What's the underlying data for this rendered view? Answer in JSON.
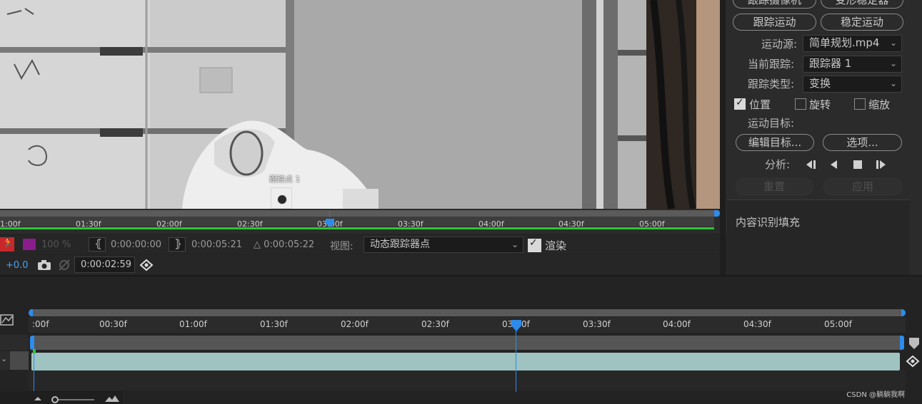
{
  "viewer": {
    "track_point_label": "跟踪点 1"
  },
  "viewer_ruler": {
    "ticks": [
      "1:00f",
      "01:30f",
      "02:00f",
      "02:30f",
      "03:00f",
      "03:30f",
      "04:00f",
      "04:30f",
      "05:00f"
    ]
  },
  "viewer_controls": {
    "zoom": "100 %",
    "in_point": "0:00:00:00",
    "out_point": "0:00:05:21",
    "duration": "△ 0:00:05:22",
    "view_label": "视图:",
    "view_value": "动态跟踪器点",
    "render_label": "渲染",
    "exposure": "+0.0",
    "current_time": "0:00:02:59"
  },
  "tracker_panel": {
    "top_buttons": [
      "跟踪摄像机",
      "变形稳定器"
    ],
    "track_motion": "跟踪运动",
    "stabilize_motion": "稳定运动",
    "motion_source_label": "运动源:",
    "motion_source_value": "简单规划.mp4",
    "current_track_label": "当前跟踪:",
    "current_track_value": "跟踪器 1",
    "track_type_label": "跟踪类型:",
    "track_type_value": "变换",
    "position_label": "位置",
    "rotation_label": "旋转",
    "scale_label": "缩放",
    "motion_target_label": "运动目标:",
    "edit_target": "编辑目标...",
    "options": "选项...",
    "analyze_label": "分析:",
    "reset": "重置",
    "apply": "应用",
    "content_aware_fill": "内容识别填充"
  },
  "timeline": {
    "ticks": [
      ":00f",
      "00:30f",
      "01:00f",
      "01:30f",
      "02:00f",
      "02:30f",
      "03:00f",
      "03:30f",
      "04:00f",
      "04:30f",
      "05:00f"
    ]
  },
  "watermark": "CSDN @躺躺我啊",
  "colors": {
    "accent_blue": "#2d8ceb",
    "green_bar": "#2fc43a",
    "layer_teal": "#9fc3c1"
  }
}
